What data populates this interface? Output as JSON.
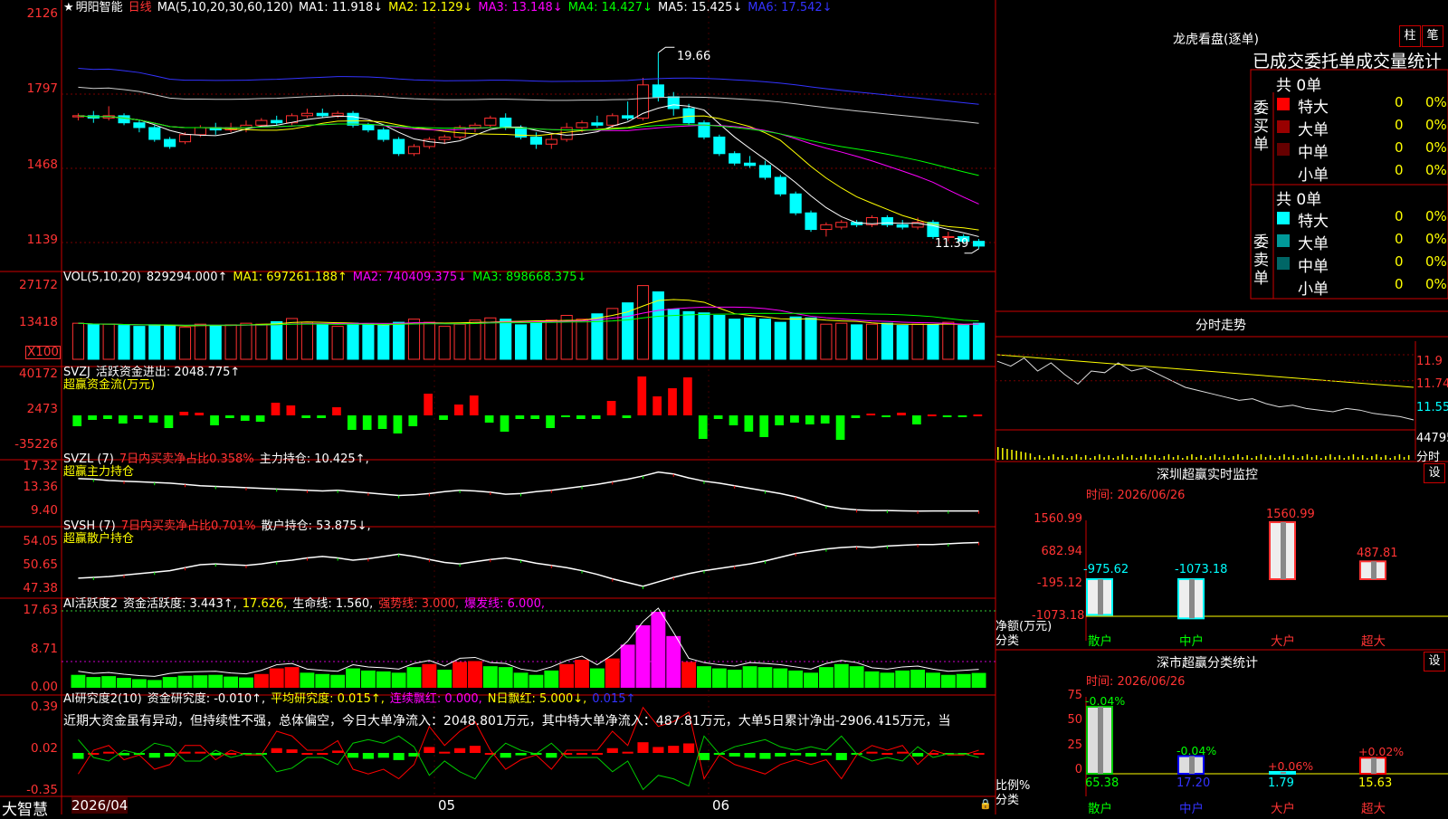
{
  "stock": {
    "star": "★",
    "name": "明阳智能",
    "period": "日线"
  },
  "ma_header": {
    "label": "MA(5,10,20,30,60,120)",
    "ma1": "MA1: 11.918↓",
    "ma2": "MA2: 12.129↓",
    "ma3": "MA3: 13.148↓",
    "ma4": "MA4: 14.427↓",
    "ma5": "MA5: 15.425↓",
    "ma6": "MA6: 17.542↓"
  },
  "price_axis": [
    "2126",
    "1797",
    "1468",
    "1139"
  ],
  "price_labels": {
    "high": "19.66",
    "low": "11.39"
  },
  "vol_header": {
    "label": "VOL(5,10,20)",
    "value": "829294.000↑",
    "ma1": "MA1: 697261.188↑",
    "ma2": "MA2: 740409.375↓",
    "ma3": "MA3: 898668.375↓"
  },
  "vol_axis": [
    "27172",
    "13418"
  ],
  "vol_unit": "X100",
  "svzj": {
    "label": "SVZJ",
    "text": "活跃资金进出: 2048.775↑",
    "sub": "超赢资金流(万元)",
    "axis": [
      "40172",
      "2473",
      "-35226"
    ]
  },
  "svzl": {
    "label": "SVZL (7)",
    "ratio": "7日内买卖净占比0.358%",
    "hold": "主力持仓: 10.425↑,",
    "sub": "超赢主力持仓",
    "axis": [
      "17.32",
      "13.36",
      "9.40"
    ]
  },
  "svsh": {
    "label": "SVSH (7)",
    "ratio": "7日内买卖净占比0.701%",
    "hold": "散户持仓: 53.875↓,",
    "sub": "超赢散户持仓",
    "axis": [
      "54.05",
      "50.65",
      "47.38"
    ]
  },
  "ai_active": {
    "label": "AI活跃度2",
    "a": "资金活跃度: 3.443↑,",
    "b": "17.626,",
    "c": "生命线: 1.560,",
    "d": "强势线: 3.000,",
    "e": "爆发线: 6.000,",
    "axis": [
      "17.63",
      "8.71",
      "0.00"
    ]
  },
  "ai_research": {
    "label": "AI研究度2(10)",
    "a": "资金研究度: -0.010↑,",
    "b": "平均研究度: 0.015↑,",
    "c": "连续飘红: 0.000,",
    "d": "N日飘红: 5.000↓,",
    "e": "0.015↑",
    "axis": [
      "0.39",
      "0.02",
      "-0.35"
    ]
  },
  "research_note": "近期大资金虽有异动，但持续性不强，总体偏空，今日大单净流入：2048.801万元，其中特大单净流入：487.81万元，大单5日累计净出-2906.415万元，当",
  "date_axis": [
    "2026/04",
    "05",
    "06"
  ],
  "brand": "大智慧",
  "right_panel": {
    "title": "龙虎看盘(逐单)",
    "tab_bar": "柱",
    "tab_pen": "笔",
    "stats_title": "已成交委托单成交量统计",
    "buy": {
      "label": "委买单",
      "total": "共 0单",
      "rows": [
        {
          "name": "特大",
          "v": "0",
          "p": "0%",
          "color": "#ff0000"
        },
        {
          "name": "大单",
          "v": "0",
          "p": "0%",
          "color": "#990000"
        },
        {
          "name": "中单",
          "v": "0",
          "p": "0%",
          "color": "#660000"
        },
        {
          "name": "小单",
          "v": "0",
          "p": "0%",
          "color": ""
        }
      ]
    },
    "sell": {
      "label": "委卖单",
      "total": "共 0单",
      "rows": [
        {
          "name": "特大",
          "v": "0",
          "p": "0%",
          "color": "#00ffff"
        },
        {
          "name": "大单",
          "v": "0",
          "p": "0%",
          "color": "#009999"
        },
        {
          "name": "中单",
          "v": "0",
          "p": "0%",
          "color": "#006666"
        },
        {
          "name": "小单",
          "v": "0",
          "p": "0%",
          "color": ""
        }
      ]
    },
    "intraday_title": "分时走势",
    "intraday_axis": [
      "11.9",
      "11.74",
      "11.55",
      "44795",
      "分时"
    ],
    "sz_monitor": {
      "title": "深圳超赢实时监控",
      "set": "设",
      "time": "时间: 2026/06/26",
      "axis": [
        "1560.99",
        "682.94",
        "-195.12",
        "-1073.18"
      ],
      "ylabel1": "净额(万元)",
      "ylabel2": "分类",
      "bars": [
        {
          "cat": "散户",
          "value": -975.62,
          "label": "-975.62"
        },
        {
          "cat": "中户",
          "value": -1073.18,
          "label": "-1073.18"
        },
        {
          "cat": "大户",
          "value": 1560.99,
          "label": "1560.99"
        },
        {
          "cat": "超大",
          "value": 487.81,
          "label": "487.81"
        }
      ]
    },
    "sz_class": {
      "title": "深市超赢分类统计",
      "set": "设",
      "time": "时间: 2026/06/26",
      "axis": [
        "75",
        "50",
        "25",
        "0"
      ],
      "ylabel1": "比例%",
      "ylabel2": "分类",
      "bars": [
        {
          "cat": "散户",
          "value": 65.38,
          "label": "65.38",
          "delta": "-0.04%",
          "color": "#00cc00"
        },
        {
          "cat": "中户",
          "value": 17.2,
          "label": "17.20",
          "delta": "-0.04%",
          "color": "#0000ff"
        },
        {
          "cat": "大户",
          "value": 1.79,
          "label": "1.79",
          "delta": "+0.06%",
          "color": "#00ffff"
        },
        {
          "cat": "超大",
          "value": 15.63,
          "label": "15.63",
          "delta": "+0.02%",
          "color": "#ff0000"
        }
      ]
    }
  },
  "chart_data": {
    "type": "candlestick",
    "price_range": [
      11.0,
      21.5
    ],
    "ohlc": [
      [
        16.95,
        17.1,
        16.8,
        17.0
      ],
      [
        17.0,
        17.2,
        16.7,
        16.9
      ],
      [
        16.9,
        17.4,
        16.8,
        17.0
      ],
      [
        17.0,
        17.1,
        16.6,
        16.7
      ],
      [
        16.7,
        16.8,
        16.3,
        16.5
      ],
      [
        16.5,
        16.6,
        15.9,
        16.0
      ],
      [
        16.0,
        16.1,
        15.6,
        15.7
      ],
      [
        15.9,
        16.3,
        15.8,
        16.2
      ],
      [
        16.2,
        16.6,
        16.1,
        16.5
      ],
      [
        16.5,
        16.7,
        16.2,
        16.4
      ],
      [
        16.4,
        16.7,
        16.3,
        16.5
      ],
      [
        16.5,
        16.8,
        16.3,
        16.6
      ],
      [
        16.6,
        16.9,
        16.5,
        16.8
      ],
      [
        16.8,
        17.0,
        16.6,
        16.7
      ],
      [
        16.7,
        17.1,
        16.6,
        17.0
      ],
      [
        17.0,
        17.3,
        16.9,
        17.1
      ],
      [
        17.1,
        17.3,
        16.9,
        17.0
      ],
      [
        17.0,
        17.2,
        16.9,
        17.1
      ],
      [
        17.1,
        17.2,
        16.5,
        16.6
      ],
      [
        16.6,
        16.7,
        16.3,
        16.4
      ],
      [
        16.4,
        16.5,
        15.9,
        16.0
      ],
      [
        16.0,
        16.1,
        15.3,
        15.4
      ],
      [
        15.4,
        15.8,
        15.3,
        15.7
      ],
      [
        15.7,
        16.1,
        15.6,
        16.0
      ],
      [
        16.0,
        16.2,
        15.8,
        16.1
      ],
      [
        16.1,
        16.6,
        16.0,
        16.5
      ],
      [
        16.5,
        16.7,
        16.3,
        16.6
      ],
      [
        16.6,
        17.0,
        16.5,
        16.9
      ],
      [
        16.9,
        17.1,
        16.4,
        16.5
      ],
      [
        16.5,
        16.6,
        16.0,
        16.1
      ],
      [
        16.1,
        16.3,
        15.6,
        15.8
      ],
      [
        15.8,
        16.2,
        15.6,
        16.0
      ],
      [
        16.0,
        16.7,
        15.9,
        16.5
      ],
      [
        16.5,
        16.8,
        16.3,
        16.7
      ],
      [
        16.7,
        17.0,
        16.5,
        16.6
      ],
      [
        16.6,
        17.1,
        16.5,
        17.0
      ],
      [
        17.0,
        17.6,
        16.8,
        16.9
      ],
      [
        16.9,
        18.6,
        16.8,
        18.3
      ],
      [
        18.3,
        19.66,
        17.6,
        17.8
      ],
      [
        17.8,
        18.0,
        17.0,
        17.3
      ],
      [
        17.3,
        17.5,
        16.6,
        16.7
      ],
      [
        16.7,
        16.8,
        16.0,
        16.1
      ],
      [
        16.1,
        16.2,
        15.3,
        15.4
      ],
      [
        15.4,
        15.5,
        14.9,
        15.0
      ],
      [
        15.0,
        15.3,
        14.8,
        14.9
      ],
      [
        14.9,
        15.1,
        14.3,
        14.4
      ],
      [
        14.4,
        14.5,
        13.6,
        13.7
      ],
      [
        13.7,
        13.8,
        12.8,
        12.9
      ],
      [
        12.9,
        13.0,
        12.1,
        12.2
      ],
      [
        12.2,
        12.5,
        11.9,
        12.4
      ],
      [
        12.3,
        12.6,
        12.2,
        12.5
      ],
      [
        12.5,
        12.6,
        12.3,
        12.4
      ],
      [
        12.4,
        12.8,
        12.3,
        12.7
      ],
      [
        12.7,
        12.8,
        12.3,
        12.4
      ],
      [
        12.4,
        12.6,
        12.2,
        12.3
      ],
      [
        12.3,
        12.7,
        12.2,
        12.5
      ],
      [
        12.5,
        12.6,
        11.8,
        11.9
      ],
      [
        11.9,
        12.1,
        11.7,
        11.9
      ],
      [
        11.9,
        12.0,
        11.6,
        11.7
      ],
      [
        11.7,
        11.8,
        11.39,
        11.5
      ]
    ],
    "volume": [
      115,
      110,
      112,
      108,
      105,
      110,
      108,
      102,
      112,
      108,
      110,
      115,
      112,
      120,
      130,
      118,
      110,
      105,
      115,
      112,
      108,
      118,
      128,
      118,
      105,
      112,
      125,
      132,
      128,
      110,
      118,
      125,
      140,
      128,
      145,
      162,
      180,
      235,
      215,
      160,
      152,
      148,
      140,
      128,
      132,
      128,
      118,
      135,
      132,
      112,
      115,
      110,
      112,
      115,
      108,
      112,
      110,
      118,
      108,
      115
    ],
    "svzj": [
      -12,
      -5,
      -4,
      -9,
      -4,
      -8,
      -14,
      4,
      3,
      -11,
      -3,
      -6,
      -7,
      14,
      11,
      -3,
      -3,
      9,
      -16,
      -16,
      -15,
      -20,
      -12,
      24,
      -5,
      12,
      22,
      -8,
      -18,
      -4,
      -4,
      -14,
      -2,
      -4,
      -4,
      16,
      -3,
      43,
      21,
      30,
      42,
      -26,
      -4,
      -11,
      -18,
      -24,
      -11,
      -8,
      -10,
      -9,
      -27,
      -3,
      2,
      -1,
      3,
      -10,
      1,
      -2,
      -2,
      1
    ],
    "svzl": [
      15.4,
      15.3,
      15.1,
      15.0,
      14.9,
      14.8,
      14.7,
      14.5,
      14.3,
      14.2,
      14.1,
      14.0,
      13.9,
      13.8,
      13.7,
      13.6,
      13.5,
      13.6,
      13.4,
      13.2,
      13.0,
      12.8,
      12.9,
      13.1,
      13.4,
      13.6,
      13.5,
      13.3,
      13.0,
      13.1,
      13.4,
      13.6,
      13.9,
      14.2,
      14.5,
      14.9,
      15.3,
      15.8,
      16.4,
      16.1,
      15.5,
      15.0,
      14.7,
      14.3,
      13.9,
      13.5,
      13.1,
      12.6,
      11.9,
      11.2,
      10.8,
      10.6,
      10.5,
      10.5,
      10.45,
      10.4,
      10.42,
      10.43,
      10.42,
      10.42
    ],
    "svsh": [
      49.1,
      49.2,
      49.3,
      49.5,
      49.7,
      49.9,
      50.1,
      50.5,
      50.9,
      51.0,
      50.9,
      50.8,
      51.0,
      51.3,
      51.5,
      51.8,
      52.0,
      51.8,
      51.5,
      51.7,
      52.0,
      52.3,
      52.0,
      51.6,
      51.2,
      51.0,
      51.3,
      51.6,
      51.8,
      51.5,
      51.1,
      50.8,
      50.5,
      50.1,
      49.6,
      49.0,
      48.5,
      48.0,
      48.6,
      49.2,
      49.7,
      50.1,
      50.4,
      50.7,
      51.0,
      51.4,
      51.9,
      52.4,
      52.7,
      53.0,
      53.2,
      53.3,
      53.2,
      53.4,
      53.5,
      53.6,
      53.6,
      53.7,
      53.8,
      53.875
    ],
    "ai_active": [
      3.0,
      2.5,
      2.7,
      2.3,
      2.0,
      1.8,
      2.5,
      2.8,
      2.9,
      3.0,
      2.6,
      2.4,
      3.2,
      4.5,
      4.8,
      3.5,
      3.2,
      3.0,
      4.5,
      4.0,
      3.8,
      3.5,
      4.8,
      5.5,
      4.2,
      6.0,
      6.2,
      5.0,
      4.8,
      3.5,
      3.0,
      4.0,
      5.5,
      6.5,
      4.5,
      6.8,
      10.0,
      14.5,
      17.63,
      12.0,
      6.0,
      5.0,
      4.5,
      4.2,
      5.0,
      4.8,
      4.5,
      4.0,
      3.5,
      4.8,
      5.5,
      5.0,
      3.8,
      3.5,
      4.0,
      4.2,
      3.5,
      3.0,
      3.2,
      3.443
    ],
    "ai_active_color": [
      "g",
      "g",
      "g",
      "g",
      "g",
      "g",
      "g",
      "g",
      "g",
      "g",
      "g",
      "g",
      "r",
      "r",
      "r",
      "g",
      "g",
      "g",
      "g",
      "g",
      "g",
      "g",
      "g",
      "r",
      "g",
      "r",
      "r",
      "g",
      "g",
      "g",
      "g",
      "g",
      "r",
      "r",
      "g",
      "r",
      "m",
      "m",
      "m",
      "m",
      "r",
      "g",
      "g",
      "g",
      "g",
      "g",
      "g",
      "g",
      "g",
      "g",
      "g",
      "g",
      "g",
      "g",
      "g",
      "g",
      "g",
      "g",
      "g",
      "g"
    ],
    "ai_research": [
      -0.05,
      0.0,
      0.01,
      -0.02,
      -0.01,
      -0.04,
      -0.03,
      0.01,
      0.01,
      -0.02,
      0.0,
      -0.01,
      -0.01,
      0.04,
      0.03,
      0.0,
      0.0,
      0.02,
      -0.04,
      -0.05,
      -0.04,
      -0.06,
      -0.03,
      0.05,
      0.01,
      0.04,
      0.06,
      0.0,
      -0.04,
      -0.02,
      -0.01,
      -0.04,
      0.0,
      0.0,
      0.0,
      0.04,
      0.01,
      0.09,
      0.05,
      0.06,
      0.08,
      -0.06,
      -0.01,
      -0.03,
      -0.04,
      -0.05,
      -0.03,
      -0.02,
      -0.03,
      -0.02,
      -0.06,
      -0.01,
      0.01,
      0.0,
      0.01,
      -0.03,
      0.0,
      -0.01,
      -0.01,
      0.0
    ],
    "intraday": [
      11.86,
      11.83,
      11.88,
      11.8,
      11.85,
      11.78,
      11.72,
      11.8,
      11.79,
      11.85,
      11.8,
      11.82,
      11.78,
      11.74,
      11.7,
      11.68,
      11.66,
      11.64,
      11.62,
      11.63,
      11.6,
      11.58,
      11.59,
      11.57,
      11.56,
      11.55,
      11.57,
      11.56,
      11.54,
      11.53,
      11.52,
      11.5
    ]
  }
}
